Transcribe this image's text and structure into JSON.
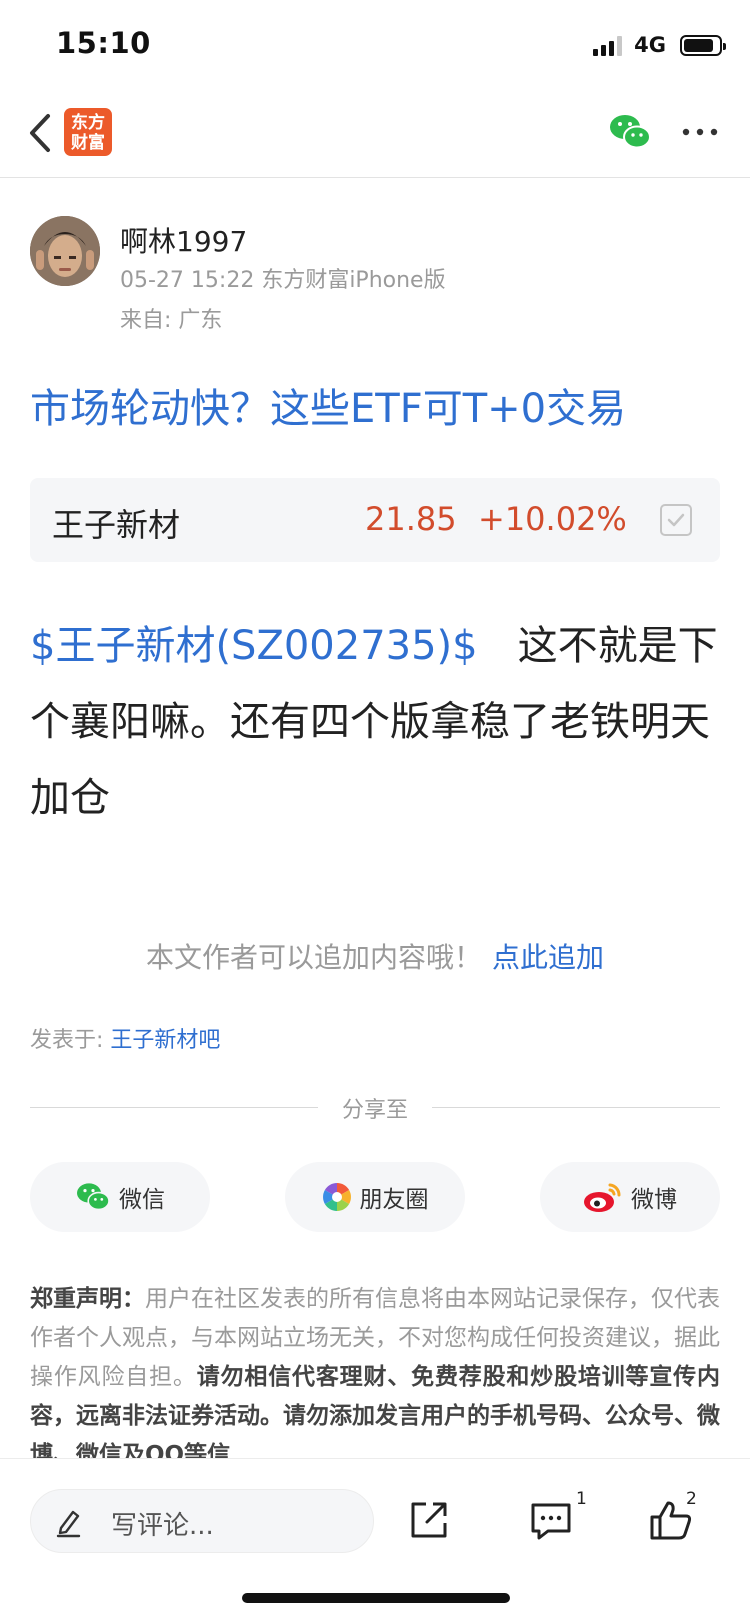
{
  "status": {
    "time": "15:10",
    "network": "4G"
  },
  "nav": {
    "logo_line1": "东方",
    "logo_line2": "财富"
  },
  "author": {
    "name": "啊林1997",
    "meta": "05-27 15:22 东方财富iPhone版",
    "location": "来自: 广东"
  },
  "promo_title": "市场轮动快？这些ETF可T+0交易",
  "stock": {
    "name": "王子新材",
    "price": "21.85",
    "change": "+10.02%",
    "color_up": "#d24c2c"
  },
  "post": {
    "stock_link": "$王子新材(SZ002735)$",
    "text": "这不就是下个襄阳嘛。还有四个版拿稳了老铁明天加仓"
  },
  "append": {
    "text": "本文作者可以追加内容哦！",
    "link": "点此追加"
  },
  "posted_in": {
    "label": "发表于: ",
    "bar": "王子新材吧"
  },
  "share": {
    "label": "分享至",
    "wechat": "微信",
    "moments": "朋友圈",
    "weibo": "微博"
  },
  "disclaimer": {
    "title": "郑重声明：",
    "text1": "用户在社区发表的所有信息将由本网站记录保存，仅代表作者个人观点，与本网站立场无关，不对您构成任何投资建议，据此操作风险自担。",
    "text2": "请勿相信代客理财、免费荐股和炒股培训等宣传内容，远离非法证券活动。请勿添加发言用户的手机号码、公众号、微博、微信及QQ等信"
  },
  "bottom": {
    "comment_placeholder": "写评论...",
    "comment_count": "1",
    "like_count": "2"
  },
  "colors": {
    "link_blue": "#2f6fd0",
    "brand_orange": "#ec5a2a",
    "wechat_green": "#2dbb4e"
  },
  "icons": [
    "back-icon",
    "wechat-icon",
    "more-icon",
    "checkbox-icon",
    "moments-icon",
    "weibo-icon",
    "pen-icon",
    "share-icon",
    "comment-icon",
    "like-icon"
  ]
}
